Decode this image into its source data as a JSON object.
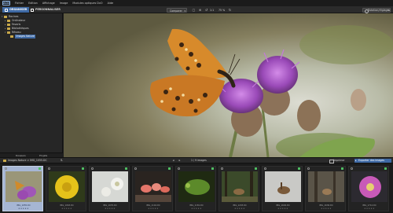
{
  "app": {
    "logo": "ACD",
    "menu": [
      "Fichier",
      "Edition",
      "Affichage",
      "Image",
      "Modules optiques DxO",
      "Aide"
    ]
  },
  "toolbar": {
    "tab_organize": "ORGANISER",
    "tab_customize": "PERSONNALISER",
    "compare": "Comparer",
    "zoom": "75 %",
    "zoom_step": "1:1",
    "workspace": "Rotation/réglages",
    "icons": [
      "fit-icon",
      "zoom-icon",
      "rotate-left-icon",
      "rotate-right-icon"
    ]
  },
  "folder_tree": {
    "items": [
      {
        "label": "Racines",
        "level": 0,
        "open": true
      },
      {
        "label": "Ordinateur",
        "level": 1,
        "open": false
      },
      {
        "label": "Favoris",
        "level": 1,
        "open": false
      },
      {
        "label": "Bibliothèques",
        "level": 1,
        "open": false
      },
      {
        "label": "Réseau",
        "level": 1,
        "open": true
      },
      {
        "label": "Images Nature",
        "level": 2,
        "open": false,
        "selected": true
      }
    ],
    "tabs": [
      "Dossiers",
      "Projets"
    ]
  },
  "filmstrip_bar": {
    "path": "Images Nature > IMG_1055.DC",
    "count": "1 / 9 images",
    "print": "Imprimer",
    "export": "Exporter des images"
  },
  "thumbnails": [
    {
      "name": "IMG_1055.DC",
      "selected": true,
      "kind": "butterfly"
    },
    {
      "name": "IMG_1063.DC",
      "selected": false,
      "kind": "yellow-flower"
    },
    {
      "name": "IMG_1070.DC",
      "selected": false,
      "kind": "white-flower"
    },
    {
      "name": "IMG_1116.DC",
      "selected": false,
      "kind": "flamingos"
    },
    {
      "name": "IMG_1181.DC",
      "selected": false,
      "kind": "chameleon"
    },
    {
      "name": "IMG_1203.DC",
      "selected": false,
      "kind": "deer-forest"
    },
    {
      "name": "IMG_1602.DC",
      "selected": false,
      "kind": "deer-snow"
    },
    {
      "name": "IMG_1636.DC",
      "selected": false,
      "kind": "deer-woods"
    },
    {
      "name": "IMG_1712.DC",
      "selected": false,
      "kind": "pink-flower"
    }
  ],
  "colors": {
    "accent": "#3f6aa5",
    "flag_green": "#4fbf63"
  }
}
